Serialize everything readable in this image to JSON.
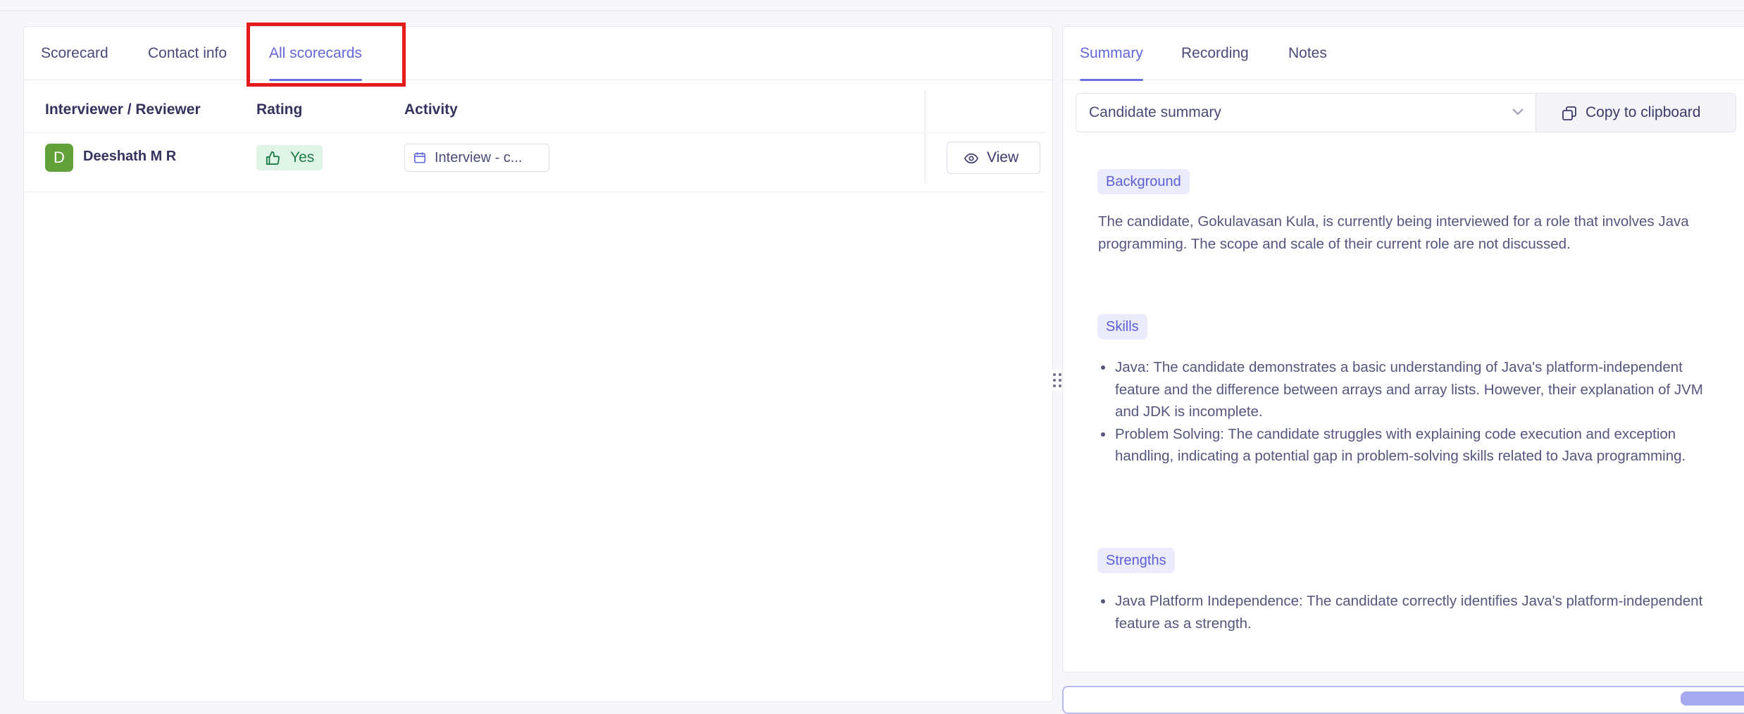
{
  "left_tabs": [
    "Scorecard",
    "Contact info",
    "All scorecards"
  ],
  "table": {
    "headers": [
      "Interviewer / Reviewer",
      "Rating",
      "Activity"
    ],
    "rows": [
      {
        "avatar_initial": "D",
        "reviewer": "Deeshath M R",
        "rating": "Yes",
        "activity": "Interview - c...",
        "action": "View"
      }
    ]
  },
  "right_tabs": [
    "Summary",
    "Recording",
    "Notes"
  ],
  "summary_select": {
    "value": "Candidate summary"
  },
  "copy_button": "Copy to clipboard",
  "sections": {
    "background": {
      "title": "Background",
      "text": "The candidate, Gokulavasan Kula, is currently being interviewed for a role that involves Java programming. The scope and scale of their current role are not discussed."
    },
    "skills": {
      "title": "Skills",
      "items": [
        "Java: The candidate demonstrates a basic understanding of Java's platform-independent feature and the difference between arrays and array lists. However, their explanation of JVM and JDK is incomplete.",
        "Problem Solving: The candidate struggles with explaining code execution and exception handling, indicating a potential gap in problem-solving skills related to Java programming."
      ]
    },
    "strengths": {
      "title": "Strengths",
      "items": [
        "Java Platform Independence: The candidate correctly identifies Java's platform-independent feature as a strength."
      ]
    }
  },
  "colors": {
    "accent": "#6366d9",
    "highlight": "#e51b1b",
    "rating_bg": "#dff3e6",
    "avatar": "#62a03a"
  }
}
